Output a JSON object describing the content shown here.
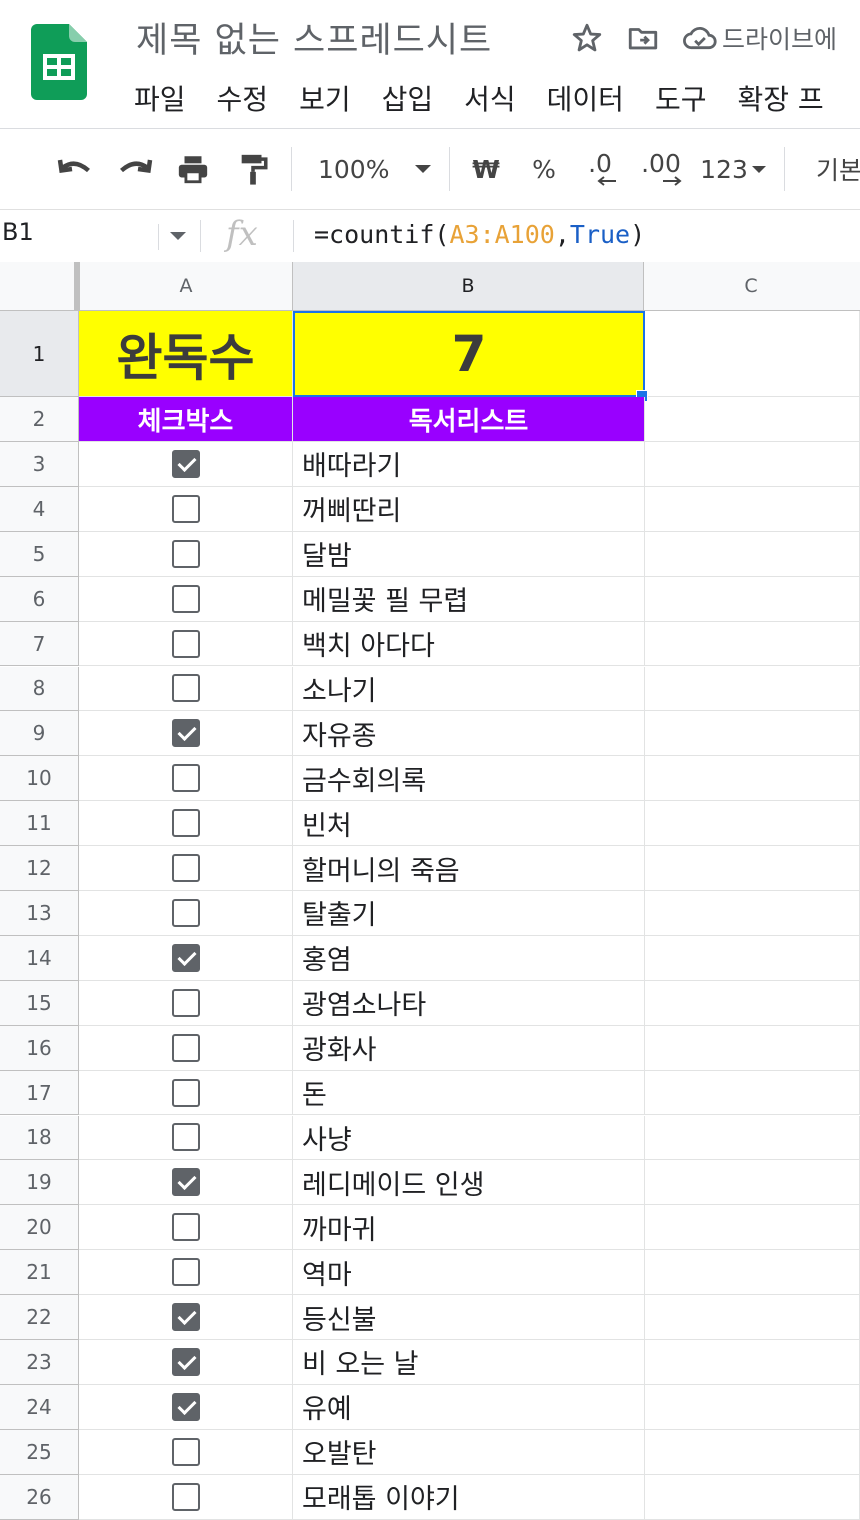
{
  "app": {
    "title": "제목 없는 스프레드시트",
    "drive_status": "드라이브에",
    "brand_color": "#0f9d58"
  },
  "menu": [
    "파일",
    "수정",
    "보기",
    "삽입",
    "서식",
    "데이터",
    "도구",
    "확장 프"
  ],
  "toolbar": {
    "undo_icon": "undo-icon",
    "redo_icon": "redo-icon",
    "print_icon": "print-icon",
    "paint_format_icon": "paint-format-icon",
    "zoom": "100%",
    "currency": "₩",
    "percent": "%",
    "decrease_decimal": ".0",
    "increase_decimal": ".00",
    "number_format": "123",
    "font": "기본"
  },
  "formula_bar": {
    "name_box": "B1",
    "fx_label": "fx",
    "formula_prefix": "=countif(",
    "formula_range": "A3:A100",
    "formula_comma": ",",
    "formula_bool": "True",
    "formula_suffix": ")"
  },
  "columns": [
    "A",
    "B",
    "C"
  ],
  "selected_cell": "B1",
  "header_rows": {
    "row1": {
      "num": "1",
      "a": "완독수",
      "b": "7",
      "fill": "#ffff00"
    },
    "row2": {
      "num": "2",
      "a": "체크박스",
      "b": "독서리스트",
      "fill": "#9900ff"
    }
  },
  "rows": [
    {
      "num": "3",
      "checked": true,
      "title": "배따라기"
    },
    {
      "num": "4",
      "checked": false,
      "title": "꺼삐딴리"
    },
    {
      "num": "5",
      "checked": false,
      "title": "달밤"
    },
    {
      "num": "6",
      "checked": false,
      "title": "메밀꽃 필 무렵"
    },
    {
      "num": "7",
      "checked": false,
      "title": "백치 아다다"
    },
    {
      "num": "8",
      "checked": false,
      "title": "소나기"
    },
    {
      "num": "9",
      "checked": true,
      "title": "자유종"
    },
    {
      "num": "10",
      "checked": false,
      "title": "금수회의록"
    },
    {
      "num": "11",
      "checked": false,
      "title": "빈처"
    },
    {
      "num": "12",
      "checked": false,
      "title": "할머니의 죽음"
    },
    {
      "num": "13",
      "checked": false,
      "title": "탈출기"
    },
    {
      "num": "14",
      "checked": true,
      "title": "홍염"
    },
    {
      "num": "15",
      "checked": false,
      "title": "광염소나타"
    },
    {
      "num": "16",
      "checked": false,
      "title": "광화사"
    },
    {
      "num": "17",
      "checked": false,
      "title": "돈"
    },
    {
      "num": "18",
      "checked": false,
      "title": "사냥"
    },
    {
      "num": "19",
      "checked": true,
      "title": "레디메이드 인생"
    },
    {
      "num": "20",
      "checked": false,
      "title": "까마귀"
    },
    {
      "num": "21",
      "checked": false,
      "title": "역마"
    },
    {
      "num": "22",
      "checked": true,
      "title": "등신불"
    },
    {
      "num": "23",
      "checked": true,
      "title": "비 오는 날"
    },
    {
      "num": "24",
      "checked": true,
      "title": "유예"
    },
    {
      "num": "25",
      "checked": false,
      "title": "오발탄"
    },
    {
      "num": "26",
      "checked": false,
      "title": "모래톱 이야기"
    }
  ]
}
